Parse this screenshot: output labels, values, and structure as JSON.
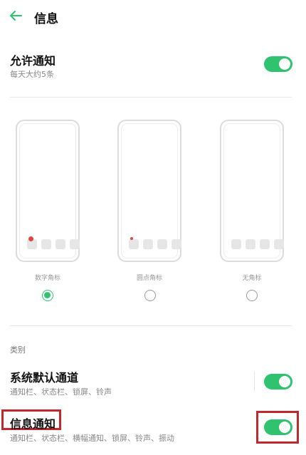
{
  "header": {
    "title": "信息",
    "back_icon": "arrow-left-icon",
    "accent": "#2fc36f"
  },
  "allow_notifications": {
    "title": "允许通知",
    "subtitle": "每天大约5条",
    "enabled": true
  },
  "badge_styles": {
    "options": [
      {
        "label": "数字角标",
        "selected": true
      },
      {
        "label": "圆点角标",
        "selected": false
      },
      {
        "label": "无角标",
        "selected": false
      }
    ]
  },
  "categories": {
    "label": "类别",
    "items": [
      {
        "title": "系统默认通道",
        "subtitle": "通知栏、状态栏、锁屏、铃声",
        "enabled": true
      },
      {
        "title": "信息通知",
        "subtitle": "通知栏、状态栏、横幅通知、锁屏、铃声、振动",
        "enabled": true
      }
    ]
  },
  "colors": {
    "toggle_on": "#2fc36f",
    "badge": "#e0463f",
    "highlight": "#c0282d"
  }
}
